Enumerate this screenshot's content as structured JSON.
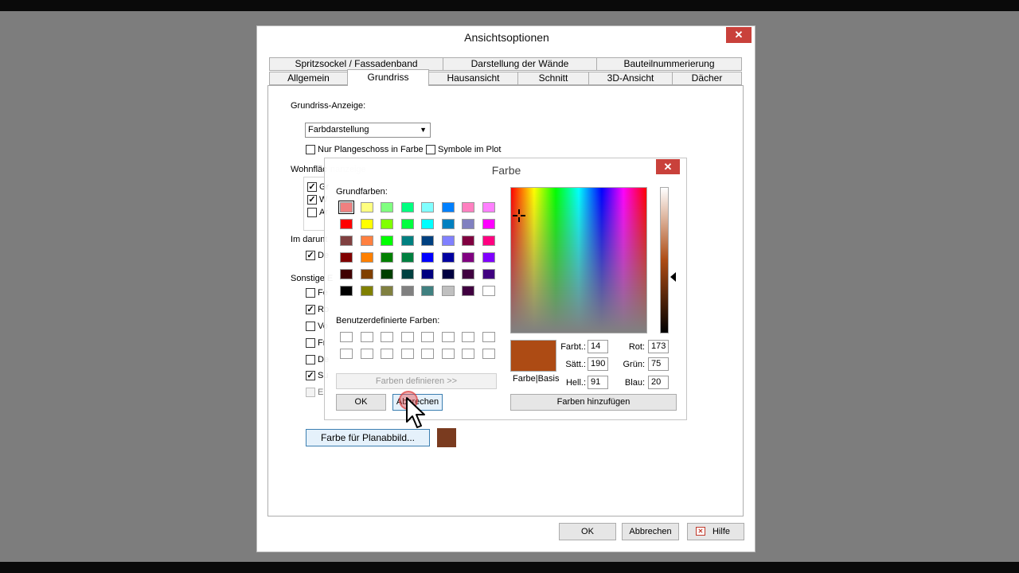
{
  "main_dialog": {
    "title": "Ansichtsoptionen",
    "close_label": "✕",
    "tabs_row1": [
      "Spritzsockel / Fassadenband",
      "Darstellung der Wände",
      "Bauteilnummerierung"
    ],
    "tabs_row2": [
      "Allgemein",
      "Grundriss",
      "Hausansicht",
      "Schnitt",
      "3D-Ansicht",
      "Dächer"
    ],
    "active_tab": "Grundriss",
    "grundriss_label": "Grundriss-Anzeige:",
    "display_select": "Farbdarstellung",
    "option_color_floor": "Nur Plangeschoss in Farbe",
    "option_symbols": "Symbole im Plot",
    "group_wohnflaeche": "Wohnfläc",
    "group_wohnflaeche_faint": "nanzeige",
    "group_darunter": "Im darunt",
    "group_sonstige": "Sonstige E",
    "short_items": [
      "Gr",
      "W",
      "Ar",
      "De",
      "Fe",
      "Ro",
      "Vo",
      "Fr",
      "De",
      "Su",
      "Er"
    ],
    "faint_items": [
      "Rollladenkästen anzeigen",
      "Deckenaussparungen anzeigen",
      "Sonnenschutzelemente anzeigen"
    ],
    "plan_color_button": "Farbe für Planabbild...",
    "plan_color_value": "#7a3b1f",
    "ok": "OK",
    "cancel": "Abbrechen",
    "help": "Hilfe"
  },
  "color_dialog": {
    "title": "Farbe",
    "close_label": "✕",
    "basic_label": "Grundfarben:",
    "custom_label": "Benutzerdefinierte Farben:",
    "define_button": "Farben definieren >>",
    "basis_label": "Farbe|Basis",
    "ok": "OK",
    "cancel": "Abbrechen",
    "add_button": "Farben hinzufügen",
    "hue_label": "Farbt.:",
    "hue": "14",
    "sat_label": "Sätt.:",
    "sat": "190",
    "lum_label": "Hell.:",
    "lum": "91",
    "red_label": "Rot:",
    "red": "173",
    "green_label": "Grün:",
    "green": "75",
    "blue_label": "Blau:",
    "blue": "20",
    "selected_color": "#ad4b14",
    "swatch_colors": [
      [
        "#f08080",
        "#ffff80",
        "#80ff80",
        "#00ff80",
        "#80ffff",
        "#0080ff",
        "#ff80c0",
        "#ff80ff"
      ],
      [
        "#ff0000",
        "#ffff00",
        "#80ff00",
        "#00ff40",
        "#00ffff",
        "#0080c0",
        "#8080c0",
        "#ff00ff"
      ],
      [
        "#804040",
        "#ff8040",
        "#00ff00",
        "#008080",
        "#004080",
        "#8080ff",
        "#800040",
        "#ff0080"
      ],
      [
        "#800000",
        "#ff8000",
        "#008000",
        "#008040",
        "#0000ff",
        "#0000a0",
        "#800080",
        "#8000ff"
      ],
      [
        "#400000",
        "#804000",
        "#004000",
        "#004040",
        "#000080",
        "#000040",
        "#400040",
        "#400080"
      ],
      [
        "#000000",
        "#808000",
        "#808040",
        "#808080",
        "#408080",
        "#c0c0c0",
        "#400040",
        "#ffffff"
      ]
    ]
  }
}
